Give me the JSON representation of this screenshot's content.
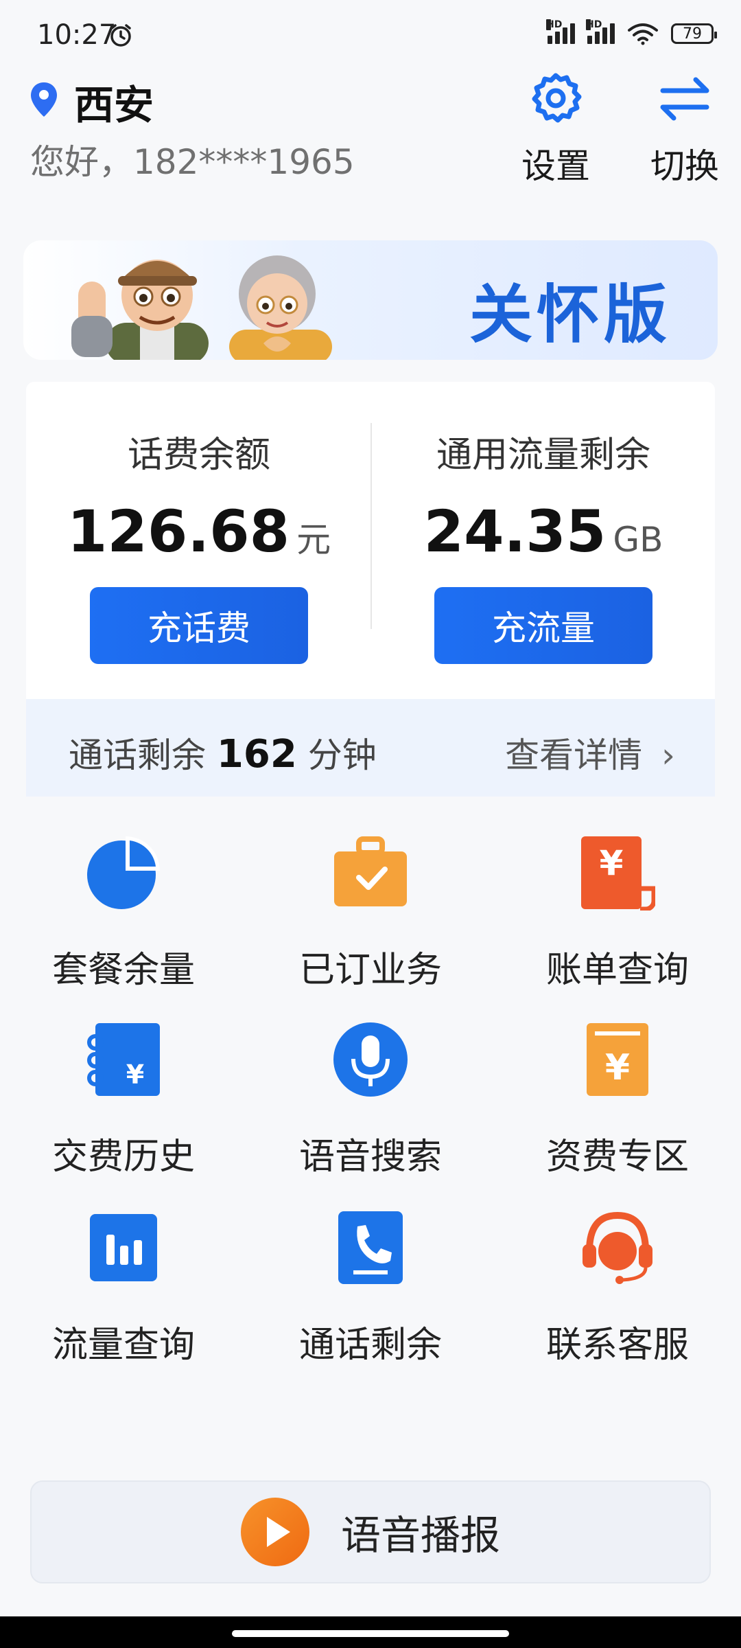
{
  "status": {
    "time": "10:27",
    "battery": "79",
    "hd1": "HD",
    "hd2": "HD"
  },
  "header": {
    "city": "西安",
    "greeting": "您好，182****1965",
    "settings_label": "设置",
    "switch_label": "切换"
  },
  "banner": {
    "title": "关怀版"
  },
  "account": {
    "balance_title": "话费余额",
    "balance_value": "126.68",
    "balance_unit": "元",
    "recharge_fee_label": "充话费",
    "data_title": "通用流量剩余",
    "data_value": "24.35",
    "data_unit": "GB",
    "recharge_data_label": "充流量",
    "call_prefix": "通话剩余",
    "call_minutes": "162",
    "call_unit": "分钟",
    "detail_label": "查看详情"
  },
  "services": [
    {
      "label": "套餐余量",
      "icon": "pie-chart-icon",
      "color": "#1d74e8"
    },
    {
      "label": "已订业务",
      "icon": "briefcase-check-icon",
      "color": "#f5a23a"
    },
    {
      "label": "账单查询",
      "icon": "bill-yen-icon",
      "color": "#ee5a2c"
    },
    {
      "label": "交费历史",
      "icon": "notebook-yen-icon",
      "color": "#1d74e8"
    },
    {
      "label": "语音搜索",
      "icon": "microphone-icon",
      "color": "#1d74e8"
    },
    {
      "label": "资费专区",
      "icon": "yen-card-icon",
      "color": "#f5a23a"
    },
    {
      "label": "流量查询",
      "icon": "bar-chart-icon",
      "color": "#1d74e8"
    },
    {
      "label": "通话剩余",
      "icon": "phone-icon",
      "color": "#1d74e8"
    },
    {
      "label": "联系客服",
      "icon": "headset-icon",
      "color": "#ee5a2c"
    }
  ],
  "voice_broadcast": {
    "label": "语音播报"
  }
}
